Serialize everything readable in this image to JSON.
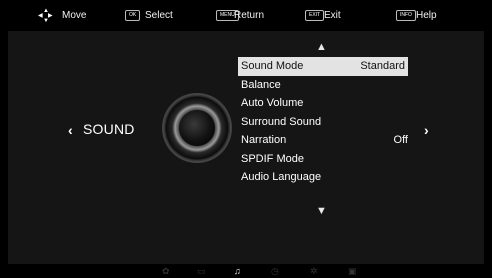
{
  "hints": {
    "move": "Move",
    "select_key": "OK",
    "select": "Select",
    "return_key": "MENU",
    "return": "Return",
    "exit_key": "EXIT",
    "exit": "Exit",
    "help_key": "INFO",
    "help": "Help"
  },
  "section": {
    "title": "SOUND"
  },
  "menu": {
    "items": [
      {
        "label": "Sound Mode",
        "value": "Standard"
      },
      {
        "label": "Balance",
        "value": ""
      },
      {
        "label": "Auto Volume",
        "value": ""
      },
      {
        "label": "Surround Sound",
        "value": ""
      },
      {
        "label": "Narration",
        "value": "Off"
      },
      {
        "label": "SPDIF Mode",
        "value": ""
      },
      {
        "label": "Audio Language",
        "value": ""
      }
    ],
    "selected_index": 0
  },
  "bottom_tabs": {
    "icons": [
      "picture-icon",
      "screen-icon",
      "sound-icon",
      "time-icon",
      "settings-icon",
      "lock-icon"
    ],
    "active_index": 2
  },
  "colors": {
    "background": "#000000",
    "panel": "#151515",
    "highlight": "#e3e3e3"
  }
}
